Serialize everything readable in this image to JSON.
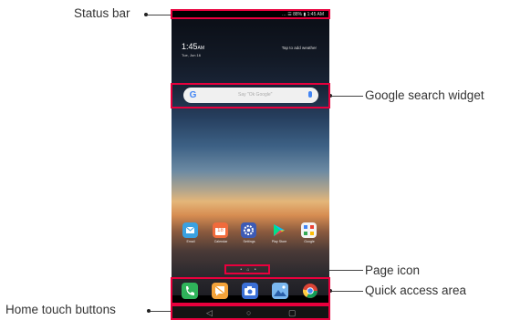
{
  "callouts": {
    "status_bar": "Status bar",
    "google_search_widget": "Google search widget",
    "page_icon": "Page icon",
    "quick_access_area": "Quick access area",
    "home_touch_buttons": "Home touch buttons"
  },
  "phone": {
    "status_text": "… ☰ 88% ▮ 1:45 AM",
    "clock_time": "1:45",
    "clock_ampm": "AM",
    "date": "Tue, Jun 16",
    "weather_hint": "Tap to add weather",
    "search_placeholder": "Say \"Ok Google\"",
    "google_letter": "G",
    "apps": [
      {
        "label": "Email",
        "color": "#3aa1e0"
      },
      {
        "label": "Calendar",
        "color": "#f06b3c"
      },
      {
        "label": "Settings",
        "color": "#3d5bb5"
      },
      {
        "label": "Play Store",
        "color": "#f2f2f2"
      },
      {
        "label": "Google",
        "color": "#f4f4f4"
      }
    ],
    "calendar_day": "18",
    "page_indicator": "• ⌂ •",
    "quick_access": [
      {
        "name": "phone",
        "color": "#2fb35a"
      },
      {
        "name": "messages",
        "color": "#f5a33a"
      },
      {
        "name": "camera",
        "color": "#3b6fd6"
      },
      {
        "name": "gallery",
        "color": "#3f88d8"
      },
      {
        "name": "chrome",
        "color": "#e8e8e8"
      }
    ],
    "nav_buttons": {
      "back": "◁",
      "home": "○",
      "recents": "▢"
    }
  },
  "colors": {
    "highlight": "#e8003d"
  }
}
